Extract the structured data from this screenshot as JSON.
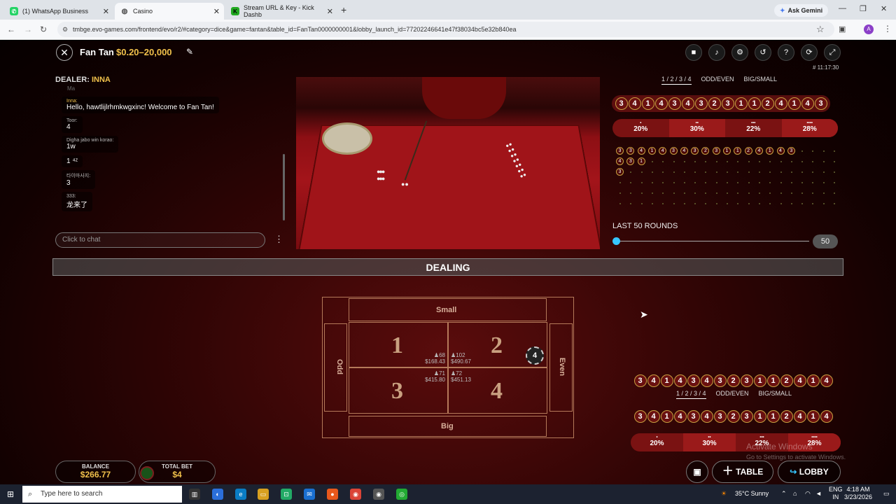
{
  "browser": {
    "tabs": [
      {
        "title": "(1) WhatsApp Business",
        "icon": "whatsapp-icon",
        "active": false
      },
      {
        "title": "Casino",
        "icon": "globe-icon",
        "active": true
      },
      {
        "title": "Stream URL & Key - Kick Dashb",
        "icon": "kick-icon",
        "active": false
      }
    ],
    "new_tab": "+",
    "ask_gemini": "Ask Gemini",
    "url": "tmbge.evo-games.com/frontend/evo/r2/#category=dice&game=fantan&table_id=FanTan0000000001&lobby_launch_id=77202246641e47f38034bc5e32b840ea",
    "profile_initial": "A"
  },
  "game": {
    "title": "Fan Tan",
    "limits": "$0.20–20,000",
    "time": "# 11:17:30",
    "dealer_label": "DEALER:",
    "dealer_name": "INNA",
    "chat_partial_name": "Ma",
    "chat": [
      {
        "name": "Inna:",
        "text": "Hello, hawtlijlrhmkwgxinc! Welcome to Fan Tan!",
        "dealer": true
      },
      {
        "name": "Toor:",
        "text": "4",
        "dealer": false
      },
      {
        "name": "Digha jabo win korao:",
        "text": "1w",
        "dealer": false
      },
      {
        "name": "",
        "text": "1 ⁴ᶻ",
        "dealer": false
      },
      {
        "name": "타이마사지:",
        "text": "3",
        "dealer": false
      },
      {
        "name": "333:",
        "text": "龙来了",
        "dealer": false
      }
    ],
    "chat_placeholder": "Click to chat",
    "stats_tabs": [
      "1 / 2 / 3 / 4",
      "ODD/EVEN",
      "BIG/SMALL"
    ],
    "road_top": [
      "3",
      "4",
      "1",
      "4",
      "3",
      "4",
      "3",
      "2",
      "3",
      "1",
      "1",
      "2",
      "4",
      "1",
      "4",
      "3"
    ],
    "percentages": [
      {
        "dots": "•",
        "value": "20%"
      },
      {
        "dots": "••",
        "value": "30%"
      },
      {
        "dots": "•••",
        "value": "22%"
      },
      {
        "dots": "••••",
        "value": "28%"
      }
    ],
    "bead_row1": [
      "3",
      "3",
      "4",
      "1",
      "4",
      "3",
      "4",
      "3",
      "2",
      "3",
      "1",
      "1",
      "2",
      "4",
      "1",
      "4",
      "3"
    ],
    "bead_row2": [
      "4",
      "3",
      "1"
    ],
    "bead_row3": [
      "3"
    ],
    "last_rounds_label": "LAST 50 ROUNDS",
    "last_rounds_value": "50",
    "status": "DEALING",
    "board": {
      "small": "Small",
      "big": "Big",
      "odd": "Odd",
      "even": "Even",
      "nums": [
        "1",
        "2",
        "3",
        "4"
      ],
      "stat1_players": "♟68",
      "stat1_amount": "$168.43",
      "stat2_players": "♟102",
      "stat2_amount": "$490.67",
      "stat3_players": "♟71",
      "stat3_amount": "$415.80",
      "stat4_players": "♟72",
      "stat4_amount": "$451.13",
      "chip_value": "4"
    },
    "road_bottom1": [
      "3",
      "4",
      "1",
      "4",
      "3",
      "4",
      "3",
      "2",
      "3",
      "1",
      "1",
      "2",
      "4",
      "1",
      "4"
    ],
    "road_bottom2": [
      "3",
      "4",
      "1",
      "4",
      "3",
      "4",
      "3",
      "2",
      "3",
      "1",
      "1",
      "2",
      "4",
      "1",
      "4"
    ],
    "bottom_stats_tabs": [
      "1 / 2 / 3 / 4",
      "ODD/EVEN",
      "BIG/SMALL"
    ],
    "bottom_percentages": [
      {
        "dots": "•",
        "value": "20%"
      },
      {
        "dots": "••",
        "value": "30%"
      },
      {
        "dots": "•••",
        "value": "22%"
      },
      {
        "dots": "••••",
        "value": "28%"
      }
    ],
    "balance_label": "BALANCE",
    "balance_value": "$266.77",
    "total_bet_label": "TOTAL BET",
    "total_bet_value": "$4",
    "table_btn": "TABLE",
    "lobby_btn": "LOBBY",
    "activate_title": "Activate Windows",
    "activate_sub": "Go to Settings to activate Windows."
  },
  "taskbar": {
    "search_placeholder": "Type here to search",
    "weather": "35°C  Sunny",
    "lang": "ENG",
    "lang2": "IN",
    "time": "4:18 AM",
    "date": "3/23/2026"
  }
}
